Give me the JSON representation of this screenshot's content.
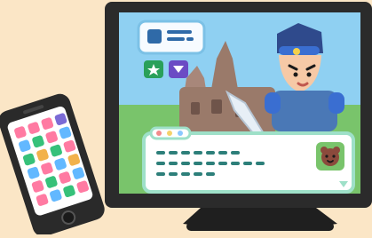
{
  "scene": {
    "subject": "monitor-with-rpg-game-and-smartphone",
    "background_color": "#fbe6c6",
    "monitor": {
      "bezel_color": "#2b2b2b",
      "stand_color": "#1f1f1f"
    },
    "game_screen": {
      "sky_color": "#8fd0f2",
      "grass_color": "#79c46b",
      "castle_color": "#9a7a6a",
      "hero": {
        "hair_color": "#2f4a8c",
        "skin_color": "#f6c9a6",
        "helmet_color": "#3a6ed1",
        "armor_color": "#4a78b6"
      },
      "sword_color": "#e7eff6",
      "status_panel": {
        "has_lines_of_dots": true
      },
      "command_buttons": [
        {
          "icon": "star-icon",
          "color": "#2aa05a"
        },
        {
          "icon": "triangle-down-icon",
          "color": "#6b4bc4"
        }
      ],
      "dialog_box": {
        "border_color": "#9ee0c8",
        "fill_color": "#ffffff",
        "dot_color": "#2d7f7a",
        "next_indicator_icon": "triangle-down-icon",
        "speaker_icon": "bear-icon"
      }
    },
    "smartphone": {
      "body_color": "#2a2a2a",
      "home_button": true
    }
  }
}
